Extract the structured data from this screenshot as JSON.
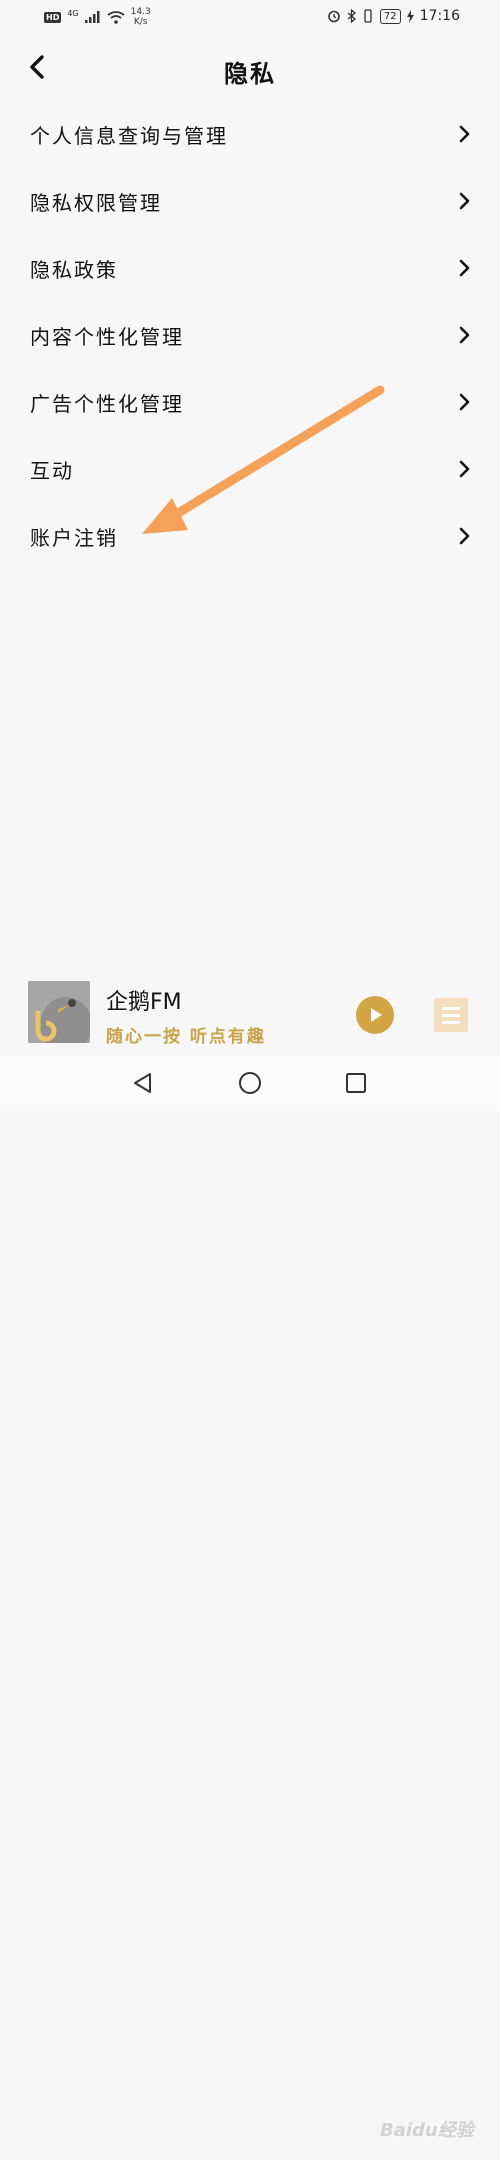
{
  "status_bar": {
    "hd": "HD",
    "signal": "4G",
    "net_speed_value": "14.3",
    "net_speed_unit": "K/s",
    "battery": "72",
    "time": "17:16"
  },
  "header": {
    "title": "隐私"
  },
  "menu": {
    "items": [
      {
        "label": "个人信息查询与管理"
      },
      {
        "label": "隐私权限管理"
      },
      {
        "label": "隐私政策"
      },
      {
        "label": "内容个性化管理"
      },
      {
        "label": "广告个性化管理"
      },
      {
        "label": "互动"
      },
      {
        "label": "账户注销"
      }
    ]
  },
  "player": {
    "title": "企鹅FM",
    "slogan": "随心一按 听点有趣"
  },
  "watermark": {
    "text": "Baidu经验"
  },
  "colors": {
    "background": "#f7f7f7",
    "accent_gold": "#d2a645",
    "annotation_arrow": "#f5a15a"
  },
  "icons": {
    "back": "chevron-left-icon",
    "menu_chevron": "chevron-right-icon",
    "play": "play-icon",
    "playlist": "playlist-icon",
    "sys_back": "triangle-back-icon",
    "sys_home": "circle-home-icon",
    "sys_recents": "square-recents-icon"
  }
}
